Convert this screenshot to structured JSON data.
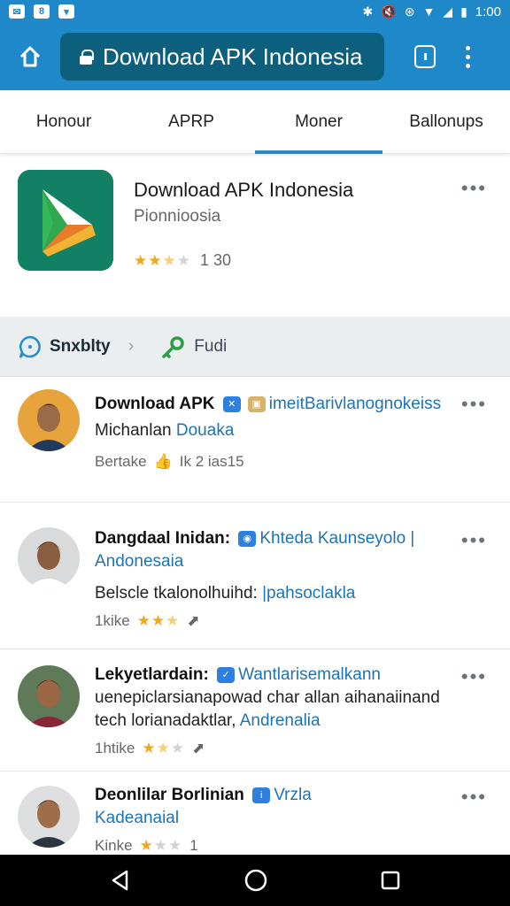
{
  "status_bar": {
    "time": "1:00"
  },
  "browser": {
    "url_title": "Download APK Indonesia"
  },
  "tabs": [
    {
      "label": "Honour"
    },
    {
      "label": "APRP"
    },
    {
      "label": "Moner"
    },
    {
      "label": "Ballonups"
    }
  ],
  "app": {
    "title": "Download APK Indonesia",
    "subtitle": "Pionnioosia",
    "rating_stars": 2.5,
    "rating_count": "1 30"
  },
  "filters": {
    "sort_label": "Snxblty",
    "edit_label": "Fudi"
  },
  "posts": [
    {
      "author": "Download APK",
      "handle": "imeitBarivlanognokeiss",
      "line2_plain": "Michanlan",
      "line2_link": "Douaka",
      "meta_text": "Bertake",
      "likes_text": "Ik 2 ias15"
    },
    {
      "author": "Dangdaal Inidan:",
      "handle": "Khteda Kaunseyolo |",
      "handle_cont": "Andonesaia",
      "line3_plain": "Belscle tkalonolhuihd:",
      "line3_link": "|pahsoclakla",
      "meta_text": "1kike",
      "rating_stars": 2.5
    },
    {
      "author": "Lekyetlardain:",
      "handle": "Wantlarisemalkann",
      "line2": "uenepiclarsianapowad char allan aihanaiinand",
      "line3_plain": "tech lorianadaktlar,",
      "line3_link": "Andrenalia",
      "meta_text": "1htike",
      "rating_stars": 1.5
    },
    {
      "author": "Deonlilar Borlinian",
      "handle": "Vrzla",
      "line2_link": "Kadeanaial",
      "meta_text": "Kinke",
      "rating_stars": 1,
      "count": "1"
    }
  ],
  "colors": {
    "primary": "#1f88c9",
    "url_bar": "#0d5f7e",
    "link": "#1e73b6",
    "star": "#f0a71a"
  }
}
